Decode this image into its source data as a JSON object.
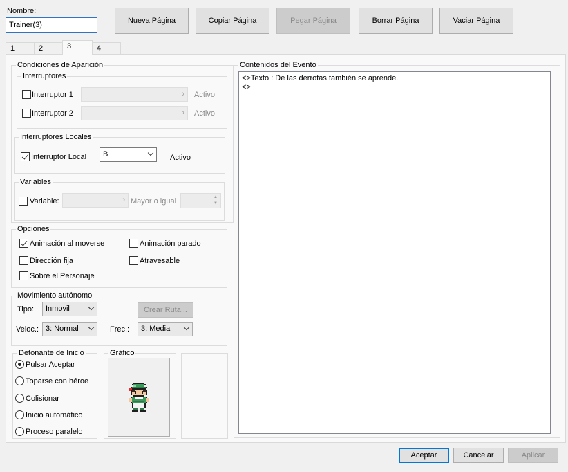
{
  "name": {
    "label": "Nombre:",
    "value": "Trainer(3)"
  },
  "toolbar": {
    "new_page": "Nueva Página",
    "copy_page": "Copiar Página",
    "paste_page": "Pegar Página",
    "delete_page": "Borrar Página",
    "clear_page": "Vaciar Página"
  },
  "tabs": [
    {
      "label": "1",
      "active": false
    },
    {
      "label": "2",
      "active": false
    },
    {
      "label": "3",
      "active": true
    },
    {
      "label": "4",
      "active": false
    }
  ],
  "conditions": {
    "title": "Condiciones de Aparición",
    "switches": {
      "title": "Interruptores",
      "switch1": {
        "label": "Interruptor 1",
        "checked": false,
        "state": "Activo"
      },
      "switch2": {
        "label": "Interruptor 2",
        "checked": false,
        "state": "Activo"
      }
    },
    "local_switches": {
      "title": "Interruptores Locales",
      "label": "Interruptor Local",
      "checked": true,
      "value": "B",
      "state": "Activo"
    },
    "variables": {
      "title": "Variables",
      "label": "Variable:",
      "checked": false,
      "comparison": "Mayor o igual"
    }
  },
  "options": {
    "title": "Opciones",
    "move_anim": {
      "label": "Animación al moverse",
      "checked": true
    },
    "stop_anim": {
      "label": "Animación parado",
      "checked": false
    },
    "fixed_dir": {
      "label": "Dirección fija",
      "checked": false
    },
    "through": {
      "label": "Atravesable",
      "checked": false
    },
    "above": {
      "label": "Sobre el Personaje",
      "checked": false
    }
  },
  "autonomous": {
    "title": "Movimiento autónomo",
    "type_label": "Tipo:",
    "type_value": "Inmovil",
    "route_button": "Crear Ruta...",
    "speed_label": "Veloc.:",
    "speed_value": "3: Normal",
    "freq_label": "Frec.:",
    "freq_value": "3: Media"
  },
  "trigger": {
    "title": "Detonante de Inicio",
    "options": [
      {
        "label": "Pulsar Aceptar",
        "selected": true
      },
      {
        "label": "Toparse con héroe",
        "selected": false
      },
      {
        "label": "Colisionar",
        "selected": false
      },
      {
        "label": "Inicio automático",
        "selected": false
      },
      {
        "label": "Proceso paralelo",
        "selected": false
      }
    ]
  },
  "graphic": {
    "title": "Gráfico"
  },
  "event_contents": {
    "title": "Contenidos del Evento",
    "lines": [
      "<>Texto : De las derrotas también se aprende.",
      "<>"
    ]
  },
  "footer": {
    "ok": "Aceptar",
    "cancel": "Cancelar",
    "apply": "Aplicar"
  },
  "colors": {
    "accent": "#0078d7",
    "name_border": "#2f73c8"
  },
  "icons": {
    "chevron": "chevron-right-icon",
    "dropdown": "chevron-down-icon",
    "character": "trainer-sprite"
  }
}
